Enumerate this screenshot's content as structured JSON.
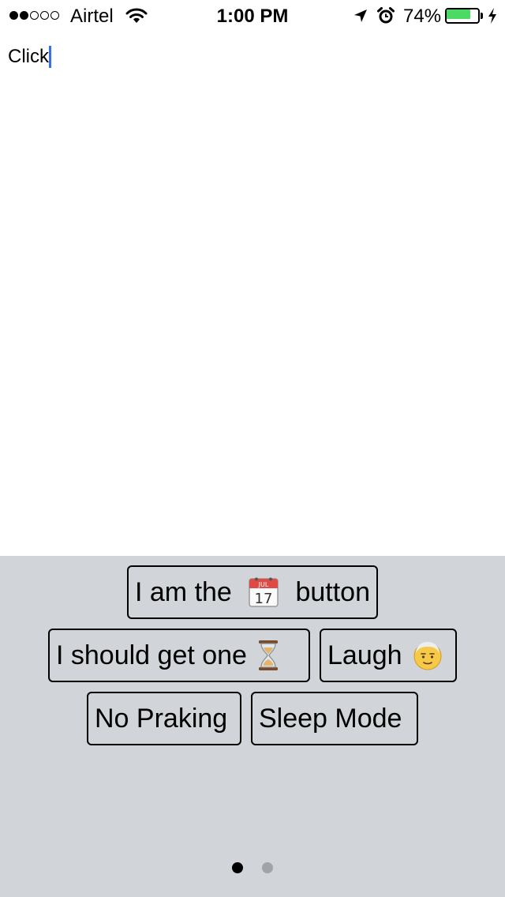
{
  "status_bar": {
    "signal_filled": 2,
    "signal_total": 5,
    "carrier": "Airtel",
    "time": "1:00 PM",
    "battery_percent_text": "74%",
    "battery_level": 0.74,
    "battery_color": "#4cd964",
    "icons": [
      "wifi-icon",
      "location-arrow-icon",
      "alarm-clock-icon",
      "battery-icon",
      "charging-bolt-icon"
    ]
  },
  "editor": {
    "text": "Click",
    "caret_color": "#3d6fe0"
  },
  "keyboard": {
    "background": "#d1d4d9",
    "rows": [
      [
        {
          "before": "I am the",
          "icon": "calendar-icon",
          "after": "button"
        }
      ],
      [
        {
          "before": "I should get one",
          "icon": "hourglass-icon",
          "after": ""
        },
        {
          "before": "Laugh",
          "icon": "face-icon",
          "after": ""
        }
      ],
      [
        {
          "before": "No Praking",
          "icon": "",
          "after": ""
        },
        {
          "before": "Sleep Mode",
          "icon": "",
          "after": ""
        }
      ]
    ],
    "calendar_month": "JUL",
    "calendar_day": "17",
    "page_count": 2,
    "active_page": 1
  }
}
